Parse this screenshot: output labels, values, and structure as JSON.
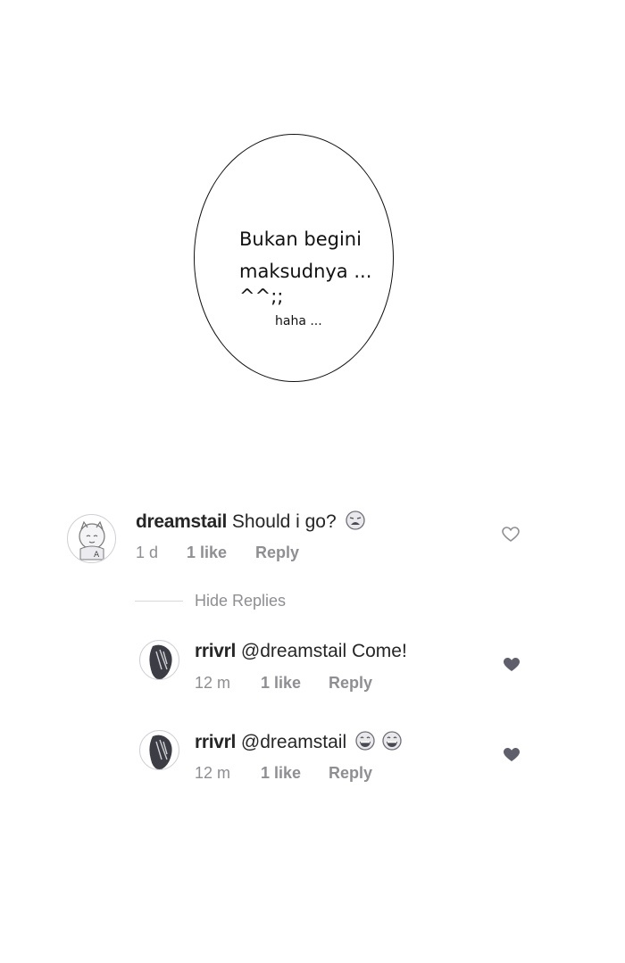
{
  "bubble": {
    "line1": "Bukan begini",
    "line2": "maksudnya ...",
    "line3": "^^;;",
    "small": "haha ..."
  },
  "comments": [
    {
      "username": "dreamstail",
      "text": "Should i go?",
      "emoji": "weary-face",
      "time": "1 d",
      "likes": "1 like",
      "reply": "Reply",
      "liked": false
    }
  ],
  "hide_replies": "Hide Replies",
  "replies": [
    {
      "username": "rrivrl",
      "text": "@dreamstail Come!",
      "time": "12 m",
      "likes": "1 like",
      "reply": "Reply",
      "liked": true
    },
    {
      "username": "rrivrl",
      "text": "@dreamstail",
      "emoji": "grinning-face",
      "time": "12 m",
      "likes": "1 like",
      "reply": "Reply",
      "liked": true
    }
  ],
  "colors": {
    "text": "#262626",
    "meta": "#8e8e93",
    "heart": "#5f5f6b"
  }
}
